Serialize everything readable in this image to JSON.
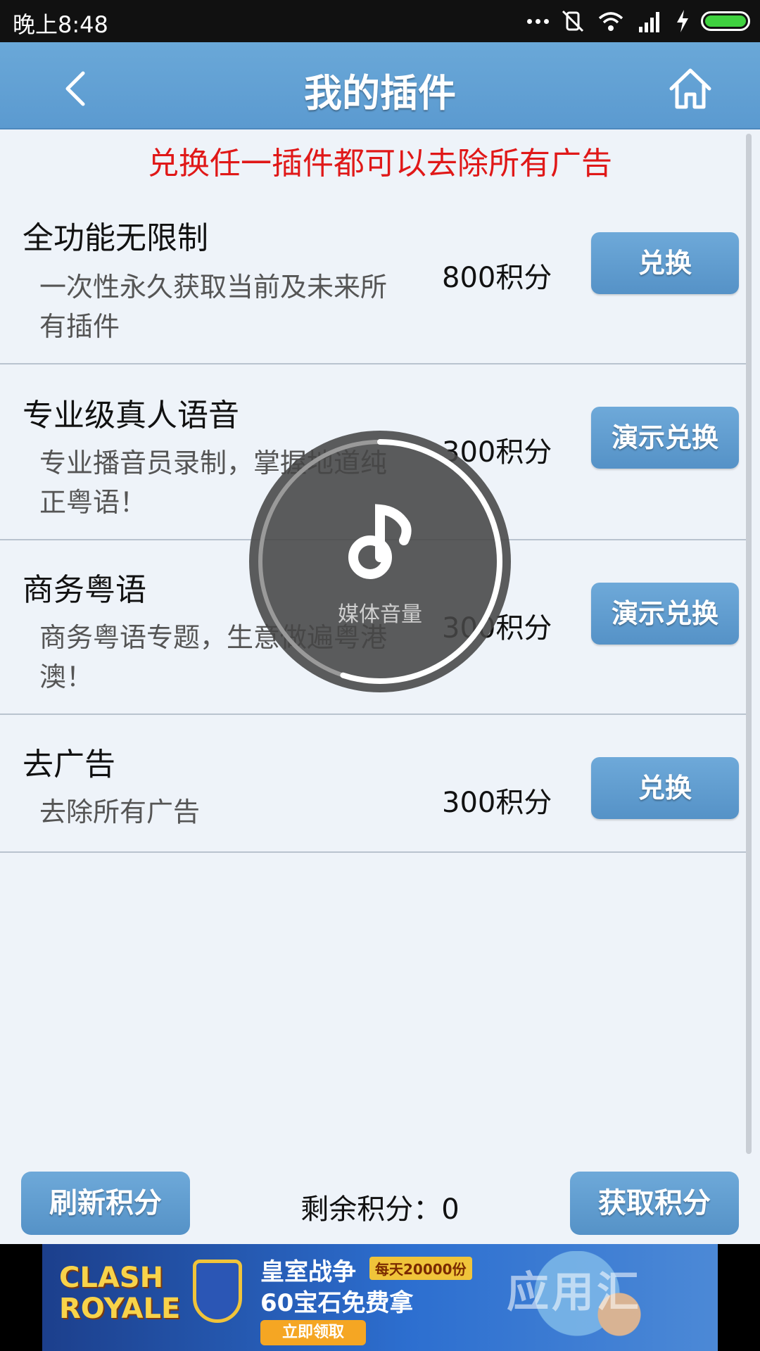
{
  "status_bar": {
    "time": "晚上8:48",
    "battery_level": 1.0
  },
  "header": {
    "title": "我的插件"
  },
  "notice": "兑换任一插件都可以去除所有广告",
  "plugins": [
    {
      "name": "全功能无限制",
      "desc": "一次性永久获取当前及未来所有插件",
      "price": "800积分",
      "button": "兑换"
    },
    {
      "name": "专业级真人语音",
      "desc": "专业播音员录制，掌握地道纯正粤语！",
      "price": "300积分",
      "button": "演示兑换"
    },
    {
      "name": "商务粤语",
      "desc": "商务粤语专题，生意做遍粤港澳！",
      "price": "300积分",
      "button": "演示兑换"
    },
    {
      "name": "去广告",
      "desc": "去除所有广告",
      "price": "300积分",
      "button": "兑换"
    }
  ],
  "footer": {
    "refresh_label": "刷新积分",
    "remaining_label": "剩余积分：0",
    "get_label": "获取积分"
  },
  "ad": {
    "logo_line1": "CLASH",
    "logo_line2": "ROYALE",
    "title": "皇室战争",
    "tag": "每天20000份",
    "subtitle": "60宝石免费拿",
    "cta": "立即领取",
    "watermark": "应用汇"
  },
  "volume_overlay": {
    "label": "媒体音量",
    "level": 0.55
  },
  "icons": {
    "back": "back-arrow-icon",
    "home": "home-icon",
    "music": "music-note-icon"
  },
  "colors": {
    "header": "#5b9ad0",
    "notice": "#e01818",
    "button": "#6ea9d9",
    "background": "#eef3f9"
  }
}
